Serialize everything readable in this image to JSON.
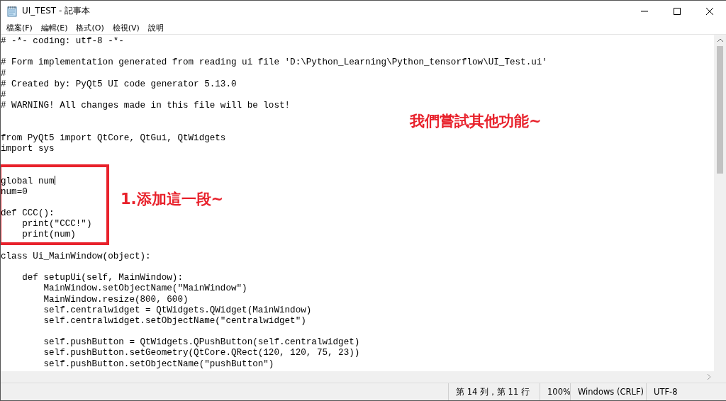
{
  "window": {
    "title": "UI_TEST - 記事本"
  },
  "menu": [
    {
      "label": "檔案(F)"
    },
    {
      "label": "編輯(E)"
    },
    {
      "label": "格式(O)"
    },
    {
      "label": "檢視(V)"
    },
    {
      "label": "說明"
    }
  ],
  "editor": {
    "lines": [
      {
        "kind": "text",
        "text": "# -*- coding: utf-8 -*-",
        "caret": false
      },
      {
        "kind": "blank"
      },
      {
        "kind": "text",
        "text": "# Form implementation generated from reading ui file 'D:\\Python_Learning\\Python_tensorflow\\UI_Test.ui'",
        "caret": false
      },
      {
        "kind": "text",
        "text": "#",
        "caret": false
      },
      {
        "kind": "text",
        "text": "# Created by: PyQt5 UI code generator 5.13.0",
        "caret": false
      },
      {
        "kind": "text",
        "text": "#",
        "caret": false
      },
      {
        "kind": "text",
        "text": "# WARNING! All changes made in this file will be lost!",
        "caret": false
      },
      {
        "kind": "blank"
      },
      {
        "kind": "blank"
      },
      {
        "kind": "text",
        "text": "from PyQt5 import QtCore, QtGui, QtWidgets",
        "caret": false
      },
      {
        "kind": "text",
        "text": "import sys",
        "caret": false
      },
      {
        "kind": "blank"
      },
      {
        "kind": "blank"
      },
      {
        "kind": "text",
        "text": "global num",
        "caret": true
      },
      {
        "kind": "text",
        "text": "num=0",
        "caret": false
      },
      {
        "kind": "blank"
      },
      {
        "kind": "text",
        "text": "def CCC():",
        "caret": false
      },
      {
        "kind": "text",
        "text": "    print(\"CCC!\")",
        "caret": false
      },
      {
        "kind": "text",
        "text": "    print(num)",
        "caret": false
      },
      {
        "kind": "blank"
      },
      {
        "kind": "text",
        "text": "class Ui_MainWindow(object):",
        "caret": false
      },
      {
        "kind": "blank"
      },
      {
        "kind": "text",
        "text": "    def setupUi(self, MainWindow):",
        "caret": false
      },
      {
        "kind": "text",
        "text": "        MainWindow.setObjectName(\"MainWindow\")",
        "caret": false
      },
      {
        "kind": "text",
        "text": "        MainWindow.resize(800, 600)",
        "caret": false
      },
      {
        "kind": "text",
        "text": "        self.centralwidget = QtWidgets.QWidget(MainWindow)",
        "caret": false
      },
      {
        "kind": "text",
        "text": "        self.centralwidget.setObjectName(\"centralwidget\")",
        "caret": false
      },
      {
        "kind": "blank"
      },
      {
        "kind": "text",
        "text": "        self.pushButton = QtWidgets.QPushButton(self.centralwidget)",
        "caret": false
      },
      {
        "kind": "text",
        "text": "        self.pushButton.setGeometry(QtCore.QRect(120, 120, 75, 23))",
        "caret": false
      },
      {
        "kind": "text",
        "text": "        self.pushButton.setObjectName(\"pushButton\")",
        "caret": false
      }
    ]
  },
  "annotations": [
    {
      "kind": "heading",
      "text": "我們嘗試其他功能~"
    },
    {
      "kind": "step",
      "text": "1.添加這一段~"
    }
  ],
  "status_bar": {
    "position": "第 14 列，第 11 行",
    "zoom": "100%",
    "line_ending": "Windows (CRLF)",
    "encoding": "UTF-8"
  }
}
